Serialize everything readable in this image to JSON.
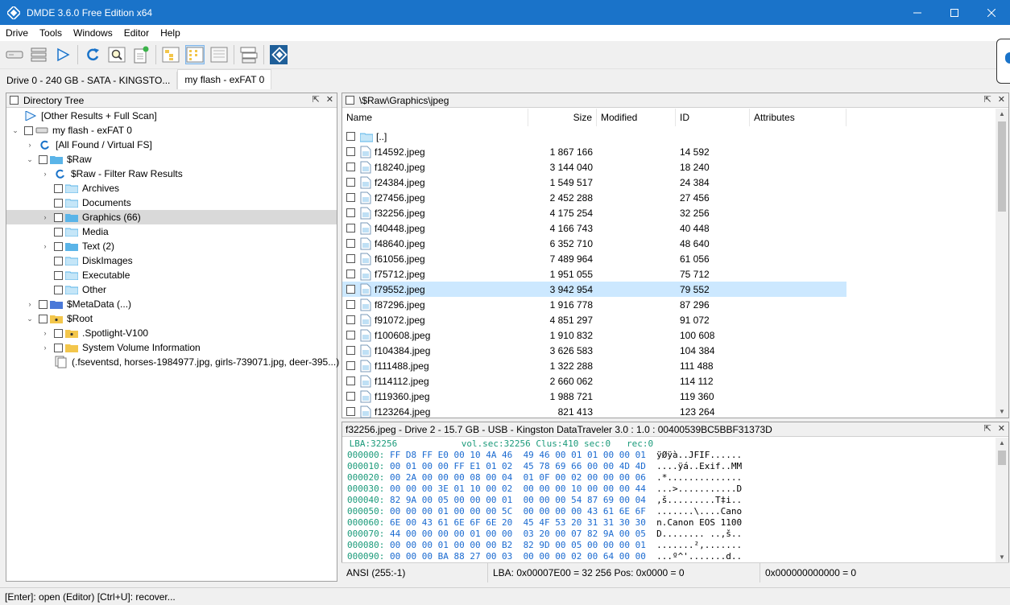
{
  "window": {
    "title": "DMDE 3.6.0 Free Edition x64"
  },
  "menu": [
    "Drive",
    "Tools",
    "Windows",
    "Editor",
    "Help"
  ],
  "toolbar": {
    "icons": [
      "drive-icon",
      "volumes-icon",
      "play-icon",
      "refresh-icon",
      "search-icon",
      "new-file-icon",
      "tree-view-icon",
      "list-view-icon",
      "details-view-icon",
      "panels-icon",
      "dmde-logo-icon"
    ]
  },
  "tabs": [
    {
      "label": "Drive 0 - 240 GB - SATA - KINGSTO..."
    },
    {
      "label": "my flash - exFAT 0"
    }
  ],
  "tree": {
    "title": "Directory Tree",
    "items": [
      {
        "label": "[Other Results + Full Scan]"
      },
      {
        "label": "my flash - exFAT 0"
      },
      {
        "label": "[All Found / Virtual FS]"
      },
      {
        "label": "$Raw"
      },
      {
        "label": "$Raw - Filter Raw Results"
      },
      {
        "label": "Archives"
      },
      {
        "label": "Documents"
      },
      {
        "label": "Graphics (66)"
      },
      {
        "label": "Media"
      },
      {
        "label": "Text (2)"
      },
      {
        "label": "DiskImages"
      },
      {
        "label": "Executable"
      },
      {
        "label": "Other"
      },
      {
        "label": "$MetaData (...)"
      },
      {
        "label": "$Root"
      },
      {
        "label": ".Spotlight-V100"
      },
      {
        "label": "System Volume Information"
      },
      {
        "label": "(.fseventsd, horses-1984977.jpg, girls-739071.jpg, deer-395...)"
      }
    ]
  },
  "files": {
    "path": "\\$Raw\\Graphics\\jpeg",
    "columns": {
      "name": "Name",
      "size": "Size",
      "modified": "Modified",
      "id": "ID",
      "attributes": "Attributes"
    },
    "rows": [
      {
        "name": "[..]",
        "size": "",
        "id": ""
      },
      {
        "name": "f14592.jpeg",
        "size": "1 867 166",
        "id": "14 592"
      },
      {
        "name": "f18240.jpeg",
        "size": "3 144 040",
        "id": "18 240"
      },
      {
        "name": "f24384.jpeg",
        "size": "1 549 517",
        "id": "24 384"
      },
      {
        "name": "f27456.jpeg",
        "size": "2 452 288",
        "id": "27 456"
      },
      {
        "name": "f32256.jpeg",
        "size": "4 175 254",
        "id": "32 256"
      },
      {
        "name": "f40448.jpeg",
        "size": "4 166 743",
        "id": "40 448"
      },
      {
        "name": "f48640.jpeg",
        "size": "6 352 710",
        "id": "48 640"
      },
      {
        "name": "f61056.jpeg",
        "size": "7 489 964",
        "id": "61 056"
      },
      {
        "name": "f75712.jpeg",
        "size": "1 951 055",
        "id": "75 712"
      },
      {
        "name": "f79552.jpeg",
        "size": "3 942 954",
        "id": "79 552"
      },
      {
        "name": "f87296.jpeg",
        "size": "1 916 778",
        "id": "87 296"
      },
      {
        "name": "f91072.jpeg",
        "size": "4 851 297",
        "id": "91 072"
      },
      {
        "name": "f100608.jpeg",
        "size": "1 910 832",
        "id": "100 608"
      },
      {
        "name": "f104384.jpeg",
        "size": "3 626 583",
        "id": "104 384"
      },
      {
        "name": "f111488.jpeg",
        "size": "1 322 288",
        "id": "111 488"
      },
      {
        "name": "f114112.jpeg",
        "size": "2 660 062",
        "id": "114 112"
      },
      {
        "name": "f119360.jpeg",
        "size": "1 988 721",
        "id": "119 360"
      },
      {
        "name": "f123264.jpeg",
        "size": "821 413",
        "id": "123 264"
      }
    ]
  },
  "hex": {
    "title": "f32256.jpeg - Drive 2 - 15.7 GB - USB - Kingston DataTraveler 3.0 : 1.0 : 00400539BC5BBF31373D",
    "info": " LBA:32256            vol.sec:32256 Clus:410 sec:0   rec:0",
    "rows": [
      {
        "off": "000000:",
        "b1": "FF D8 FF E0 00 10 4A 46",
        "b2": "49 46 00 01 01 00 00 01",
        "asc": "ÿØÿà..JFIF......"
      },
      {
        "off": "000010:",
        "b1": "00 01 00 00 FF E1 01 02",
        "b2": "45 78 69 66 00 00 4D 4D",
        "asc": "....ÿá..Exif..MM"
      },
      {
        "off": "000020:",
        "b1": "00 2A 00 00 00 08 00 04",
        "b2": "01 0F 00 02 00 00 00 06",
        "asc": ".*.............."
      },
      {
        "off": "000030:",
        "b1": "00 00 00 3E 01 10 00 02",
        "b2": "00 00 00 10 00 00 00 44",
        "asc": "...>...........D"
      },
      {
        "off": "000040:",
        "b1": "82 9A 00 05 00 00 00 01",
        "b2": "00 00 00 54 87 69 00 04",
        "asc": ",š.........T‡i.."
      },
      {
        "off": "000050:",
        "b1": "00 00 00 01 00 00 00 5C",
        "b2": "00 00 00 00 43 61 6E 6F",
        "asc": ".......\\....Cano"
      },
      {
        "off": "000060:",
        "b1": "6E 00 43 61 6E 6F 6E 20",
        "b2": "45 4F 53 20 31 31 30 30",
        "asc": "n.Canon EOS 1100"
      },
      {
        "off": "000070:",
        "b1": "44 00 00 00 00 01 00 00",
        "b2": "03 20 00 07 82 9A 00 05",
        "asc": "D........ ..,š.."
      },
      {
        "off": "000080:",
        "b1": "00 00 00 01 00 00 00 B2",
        "b2": "82 9D 00 05 00 00 00 01",
        "asc": ".......²,......."
      },
      {
        "off": "000090:",
        "b1": "00 00 00 BA 88 27 00 03",
        "b2": "00 00 00 02 00 64 00 00",
        "asc": "...º^'.......d.."
      }
    ],
    "status": {
      "mode": "ANSI (255:-1)",
      "lba": "LBA: 0x00007E00 = 32 256  Pos: 0x0000 = 0",
      "value": "0x000000000000 = 0"
    }
  },
  "statusbar": {
    "text": "[Enter]: open (Editor)  [Ctrl+U]: recover..."
  },
  "colors": {
    "titlebar": "#1a73c9",
    "selection": "#cce8ff",
    "folder": "#5ab4e8",
    "folder_yellow": "#f3c64b"
  }
}
